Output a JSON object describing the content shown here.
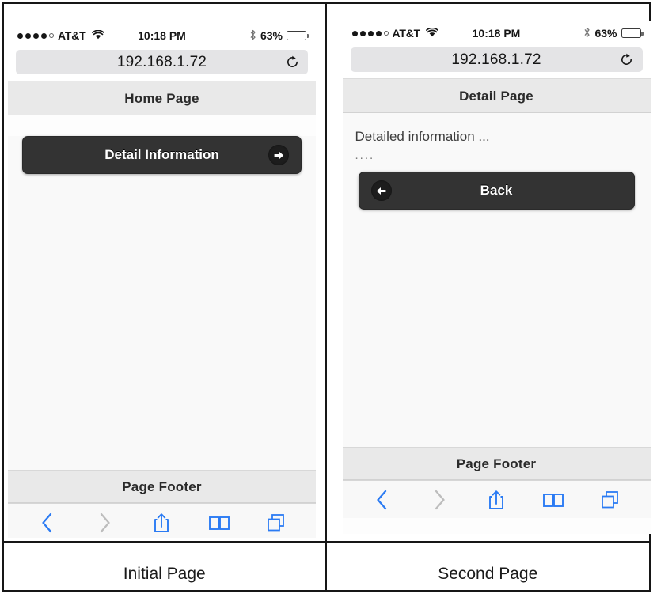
{
  "figure": {
    "captions": [
      {
        "label": "Initial Page"
      },
      {
        "label": "Second Page"
      }
    ]
  },
  "status_bar": {
    "carrier": "AT&T",
    "signal_dots_filled": 4,
    "signal_dots_empty": 1,
    "wifi_icon": "wifi-icon",
    "time": "10:18 PM",
    "bluetooth_icon": "bluetooth-icon",
    "battery_percent": "63%",
    "battery_level": 63
  },
  "browser": {
    "url": "192.168.1.72",
    "reload_icon": "reload-icon",
    "toolbar": [
      {
        "name": "back-icon",
        "label": "Back",
        "enabled": true
      },
      {
        "name": "forward-icon",
        "label": "Forward",
        "enabled": false
      },
      {
        "name": "share-icon",
        "label": "Share",
        "enabled": true
      },
      {
        "name": "bookmarks-icon",
        "label": "Bookmarks",
        "enabled": true
      },
      {
        "name": "tabs-icon",
        "label": "Tabs",
        "enabled": true
      }
    ]
  },
  "pages": {
    "home": {
      "header": "Home Page",
      "footer": "Page Footer",
      "button": {
        "label": "Detail Information",
        "icon": "arrow-right-icon"
      }
    },
    "detail": {
      "header": "Detail Page",
      "footer": "Page Footer",
      "body_line1": "Detailed information ...",
      "body_line2": "....",
      "button": {
        "label": "Back",
        "icon": "arrow-left-icon"
      }
    }
  },
  "colors": {
    "button_bg": "#333333",
    "header_bg": "#e9e9e9",
    "content_bg": "#f9f9f9",
    "toolbar_accent": "#2b7bf3",
    "toolbar_disabled": "#b8b8b8",
    "url_bar_bg": "#e4e4e6"
  }
}
